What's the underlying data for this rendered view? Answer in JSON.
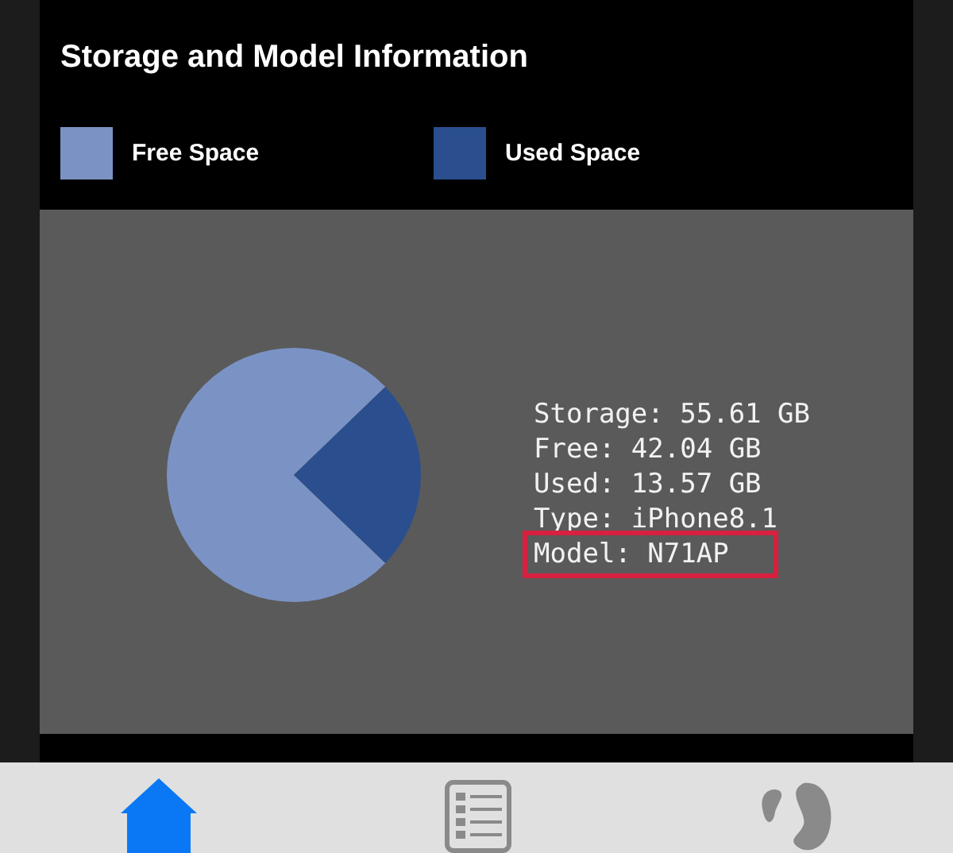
{
  "title": "Storage and Model Information",
  "legend": [
    {
      "color": "#7b93c4"
    },
    {
      "color": "#2b4f8e"
    }
  ],
  "chart_data": {
    "type": "pie",
    "categories": [
      "Free Space",
      "Used Space"
    ],
    "values": [
      75.6,
      24.4
    ]
  },
  "info_lines": [
    {
      "text": "Storage: 55.61 GB",
      "highlighted": false
    },
    {
      "text": "Free: 42.04 GB",
      "highlighted": false
    },
    {
      "text": "Used: 13.57 GB",
      "highlighted": false
    },
    {
      "text": "Type: iPhone8.1",
      "highlighted": false
    },
    {
      "text": "Model: N71AP",
      "highlighted": true
    }
  ],
  "tabs": [
    {
      "kind": "home",
      "selected": true
    },
    {
      "kind": "list",
      "selected": false
    },
    {
      "kind": "shape",
      "selected": false
    }
  ]
}
